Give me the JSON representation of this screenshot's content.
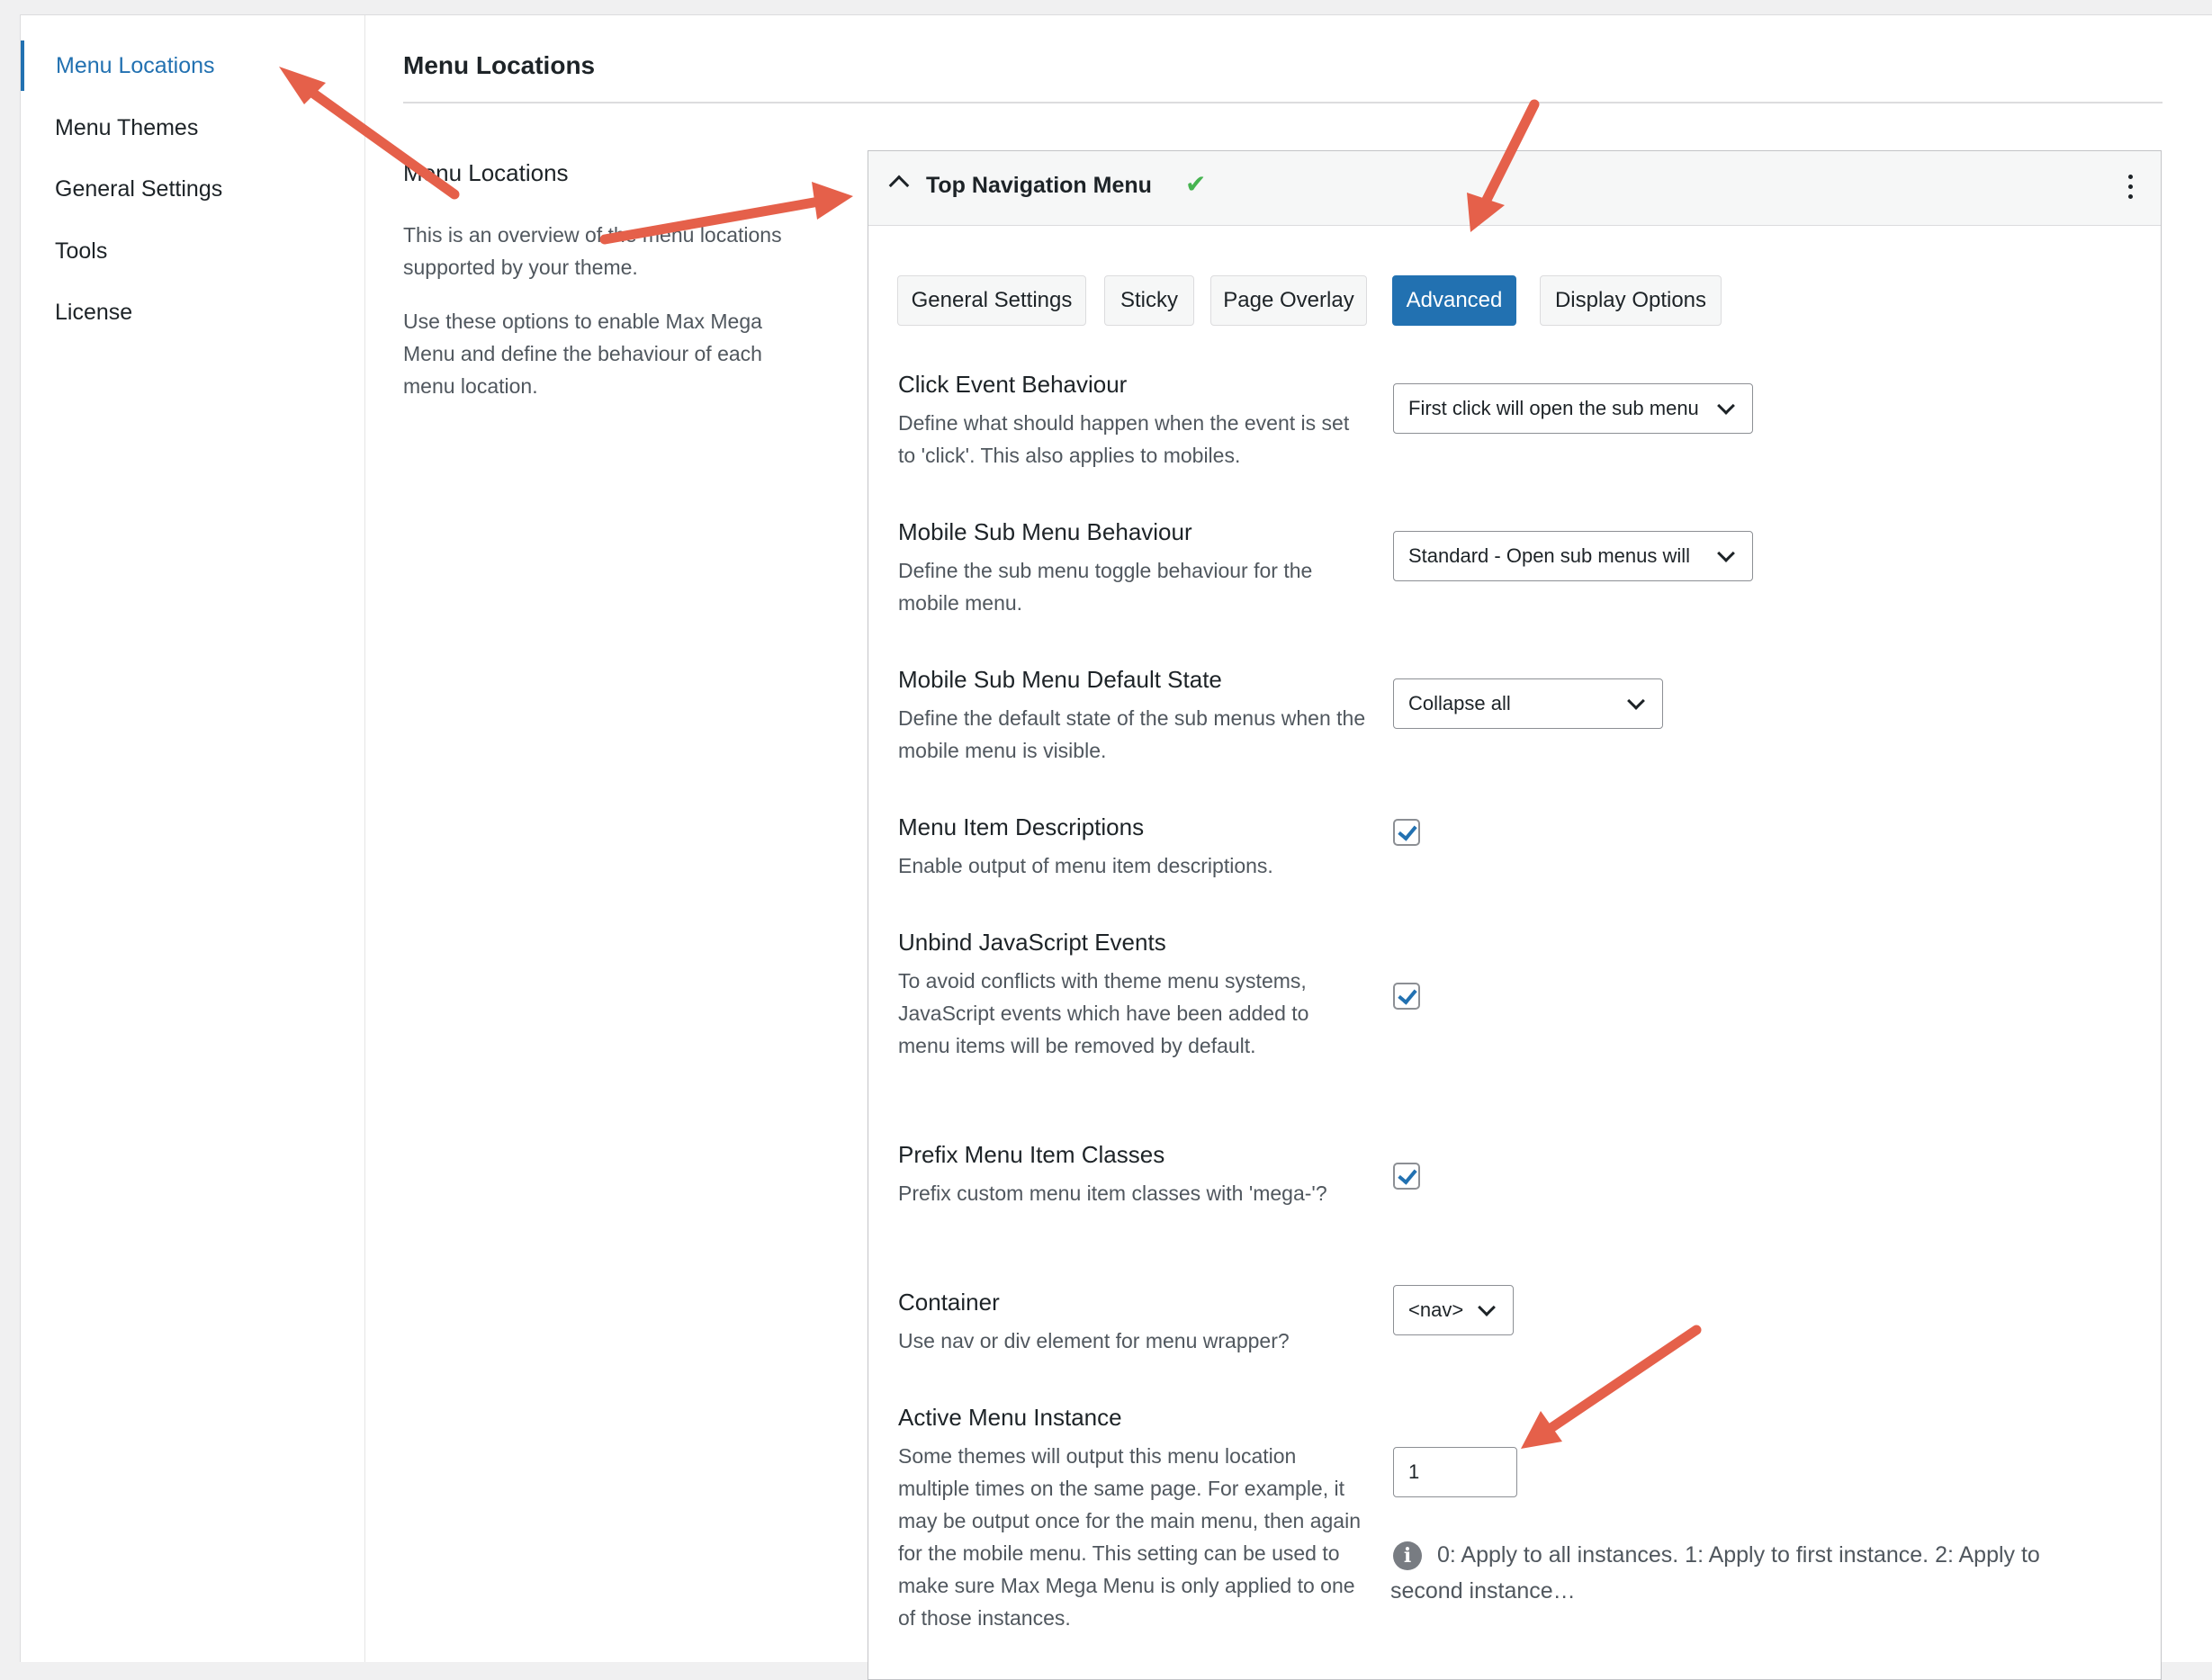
{
  "sidebar": {
    "items": [
      {
        "label": "Menu Locations",
        "active": true
      },
      {
        "label": "Menu Themes",
        "active": false
      },
      {
        "label": "General Settings",
        "active": false
      },
      {
        "label": "Tools",
        "active": false
      },
      {
        "label": "License",
        "active": false
      }
    ]
  },
  "main": {
    "title": "Menu Locations",
    "section_heading": "Menu Locations",
    "intro_1": "This is an overview of the menu locations supported by your theme.",
    "intro_2": "Use these options to enable Max Mega Menu and define the behaviour of each menu location."
  },
  "panel": {
    "title": "Top Navigation Menu",
    "status_icon": "check-icon",
    "tabs": [
      {
        "label": "General Settings",
        "active": false
      },
      {
        "label": "Sticky",
        "active": false
      },
      {
        "label": "Page Overlay",
        "active": false
      },
      {
        "label": "Advanced",
        "active": true
      },
      {
        "label": "Display Options",
        "active": false
      }
    ],
    "settings": {
      "click_event": {
        "label": "Click Event Behaviour",
        "desc": "Define what should happen when the event is set to 'click'. This also applies to mobiles.",
        "value": "First click will open the sub menu"
      },
      "mobile_sub_behaviour": {
        "label": "Mobile Sub Menu Behaviour",
        "desc": "Define the sub menu toggle behaviour for the mobile menu.",
        "value": "Standard - Open sub menus will"
      },
      "mobile_sub_default": {
        "label": "Mobile Sub Menu Default State",
        "desc": "Define the default state of the sub menus when the mobile menu is visible.",
        "value": "Collapse all"
      },
      "descriptions": {
        "label": "Menu Item Descriptions",
        "desc": "Enable output of menu item descriptions.",
        "checked": true
      },
      "unbind_js": {
        "label": "Unbind JavaScript Events",
        "desc": "To avoid conflicts with theme menu systems, JavaScript events which have been added to menu items will be removed by default.",
        "checked": true
      },
      "prefix_classes": {
        "label": "Prefix Menu Item Classes",
        "desc": "Prefix custom menu item classes with 'mega-'?",
        "checked": true
      },
      "container": {
        "label": "Container",
        "desc": "Use nav or div element for menu wrapper?",
        "value": "<nav>"
      },
      "active_instance": {
        "label": "Active Menu Instance",
        "desc": "Some themes will output this menu location multiple times on the same page. For example, it may be output once for the main menu, then again for the mobile menu. This setting can be used to make sure Max Mega Menu is only applied to one of those instances.",
        "value": "1",
        "hint": "0: Apply to all instances. 1: Apply to first instance. 2: Apply to second instance…"
      }
    }
  },
  "colors": {
    "accent": "#2271b1",
    "check": "#46b450",
    "annotation_arrow": "#e5604a"
  }
}
